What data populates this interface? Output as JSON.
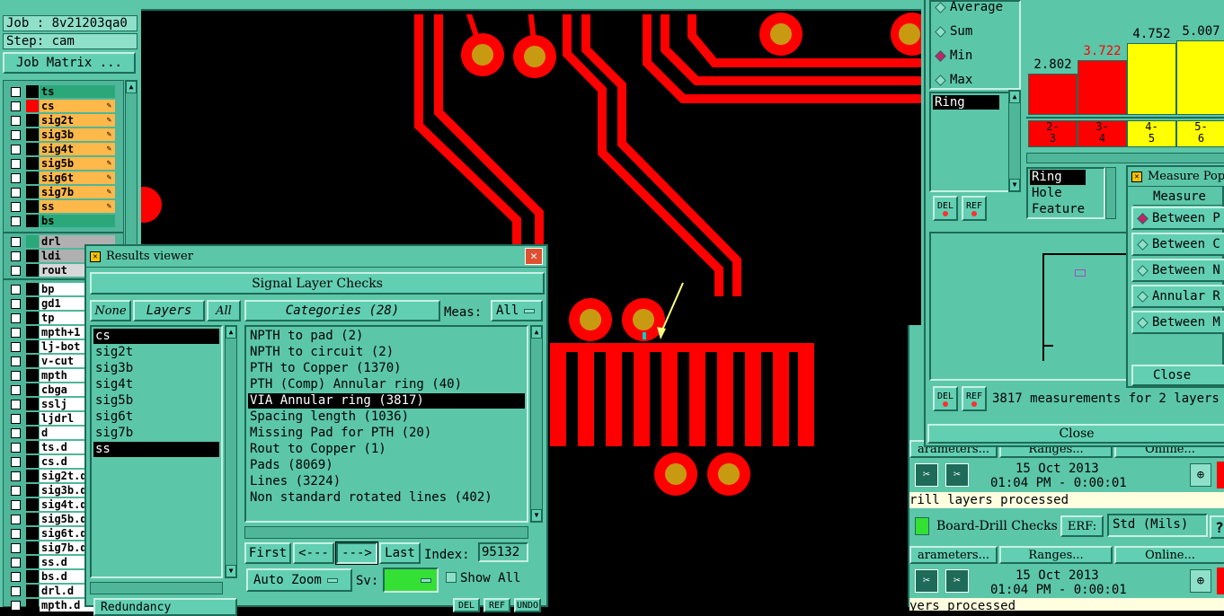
{
  "canvas_bg": "#000000",
  "accent_red": "#ff0000",
  "job": {
    "job_label": "Job : 8v21203qa0",
    "step_label": "Step: cam",
    "job_matrix": "Job Matrix ..."
  },
  "layers_board": [
    {
      "name": "ts",
      "color": "#2aa87a"
    },
    {
      "name": "cs",
      "color": "#ffb84a",
      "swatch": "#ff0000"
    },
    {
      "name": "sig2t",
      "color": "#ffb84a"
    },
    {
      "name": "sig3b",
      "color": "#ffb84a"
    },
    {
      "name": "sig4t",
      "color": "#ffb84a"
    },
    {
      "name": "sig5b",
      "color": "#ffb84a"
    },
    {
      "name": "sig6t",
      "color": "#ffb84a"
    },
    {
      "name": "sig7b",
      "color": "#ffb84a"
    },
    {
      "name": "ss",
      "color": "#ffb84a"
    },
    {
      "name": "bs",
      "color": "#2aa87a"
    }
  ],
  "layers_drill": [
    {
      "name": "drl",
      "color": "#b0b0b0",
      "swatch": "#2aa87a"
    },
    {
      "name": "ldi",
      "color": "#b0b0b0"
    },
    {
      "name": "rout",
      "color": "#d8d8d8"
    }
  ],
  "layers_misc": [
    "bp",
    "gd1",
    "tp",
    "mpth+1",
    "lj-bot",
    "v-cut",
    "mpth",
    "cbga",
    "sslj",
    "ljdrl",
    "d",
    "ts.d",
    "cs.d",
    "sig2t.d",
    "sig3b.d",
    "sig4t.d",
    "sig5b.d",
    "sig6t.d",
    "sig7b.d",
    "ss.d",
    "bs.d",
    "drl.d",
    "mpth.d"
  ],
  "results": {
    "title": "Results viewer",
    "header": "Signal Layer Checks",
    "none": "None",
    "layers": "Layers",
    "all": "All",
    "categories": "Categories (28)",
    "meas_label": "Meas:",
    "meas_value": "All",
    "layer_list": [
      "cs",
      "sig2t",
      "sig3b",
      "sig4t",
      "sig5b",
      "sig6t",
      "sig7b",
      "ss"
    ],
    "category_list": [
      "NPTH to pad (2)",
      "NPTH to circuit (2)",
      "PTH to Copper (1370)",
      "PTH (Comp) Annular ring (40)",
      "VIA Annular ring (3817)",
      "Spacing length (1036)",
      "Missing Pad for PTH (20)",
      "Rout to Copper (1)",
      "Pads (8069)",
      "Lines (3224)",
      "Non standard rotated lines (402)"
    ],
    "first": "First",
    "prev": "<---",
    "next": "--->",
    "last": "Last",
    "index_label": "Index:",
    "index_value": "95132",
    "auto_zoom": "Auto Zoom",
    "sv": "Sv:",
    "show_all": "Show All",
    "bottom_left": "Redundancy",
    "del": "DEL",
    "ref": "REF",
    "undo": "UNDO"
  },
  "histogram": {
    "stats": [
      "Average",
      "Sum",
      "Min",
      "Max"
    ],
    "selected_stat": "Min",
    "ring_field": "Ring",
    "bars": [
      {
        "value": "2.802",
        "range": [
          "2-",
          "3"
        ],
        "color": "#ff0000",
        "fill": 0.28
      },
      {
        "value": "3.722",
        "range": [
          "3-",
          "4"
        ],
        "color": "#ff0000",
        "fill": 0.37
      },
      {
        "value": "4.752",
        "range": [
          "4-",
          "5"
        ],
        "color": "#ffff00",
        "fill": 0.48
      },
      {
        "value": "5.007",
        "range": [
          "5-",
          "6"
        ],
        "color": "#ffff00",
        "fill": 0.5
      }
    ],
    "type_list": [
      "Ring",
      "Hole",
      "Feature"
    ],
    "del": "DEL",
    "ref": "REF"
  },
  "measure": {
    "title": "Measure Pop",
    "header": "Measure",
    "options": [
      "Between P",
      "Between C",
      "Between N",
      "Annular R",
      "Between M"
    ],
    "close": "Close"
  },
  "lower_right": {
    "measurements": "3817 measurements for 2 layers",
    "close": "Close"
  },
  "checklists": [
    {
      "params": "arameters...",
      "ranges": "Ranges...",
      "online": "Online...",
      "date": "15 Oct 2013",
      "time": "01:04 PM - 0:00:01",
      "status": "rill layers processed"
    },
    {
      "name": "Board-Drill Checks",
      "erf": "ERF:",
      "erf_value": "Std (Mils)",
      "help": "?",
      "params": "arameters...",
      "ranges": "Ranges...",
      "online": "Online...",
      "date": "15 Oct 2013",
      "time": "01:04 PM - 0:00:01",
      "status": "yers processed"
    }
  ]
}
